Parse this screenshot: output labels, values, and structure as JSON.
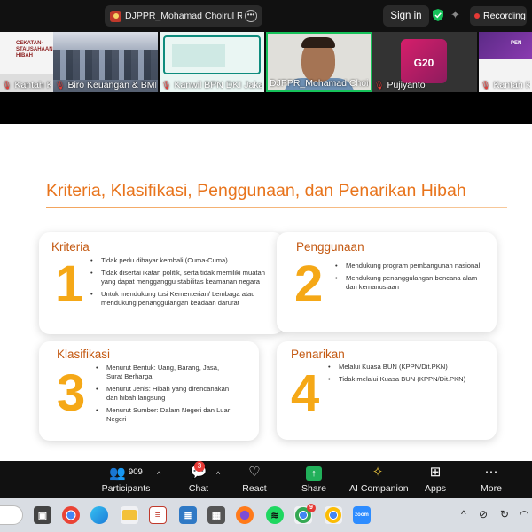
{
  "topbar": {
    "speaker_name": "DJPPR_Mohamad Choirul Rijal M",
    "sign_in": "Sign in",
    "recording": "Recording"
  },
  "gallery": {
    "tiles": [
      {
        "label": "Kantah Kab.Pa...",
        "thumb_text": "CEKATAN- STAUSAHAAN HIBAH",
        "muted": true
      },
      {
        "label": "Biro Keuangan & BMN",
        "muted": true
      },
      {
        "label": "Kanwil BPN DKI Jakart...",
        "muted": true
      },
      {
        "label": "DJPPR_Mohamad Choirul...",
        "muted": true
      },
      {
        "label": "Pujiyanto",
        "thumb_text": "G20",
        "muted": true
      },
      {
        "label": "Kantah Ko...",
        "thumb_text": "PEN",
        "muted": true
      }
    ]
  },
  "slide": {
    "title": "Kriteria, Klasifikasi, Penggunaan, dan Penarikan Hibah",
    "cards": [
      {
        "heading": "Kriteria",
        "number": "1",
        "items": [
          "Tidak perlu dibayar kembali (Cuma-Cuma)",
          "Tidak disertai ikatan politik, serta tidak memiliki muatan yang dapat mengganggu stabilitas keamanan negara",
          "Untuk mendukung tusi Kementerian/ Lembaga atau mendukung penanggulangan keadaan darurat"
        ]
      },
      {
        "heading": "Penggunaan",
        "number": "2",
        "items": [
          "Mendukung program pembangunan nasional",
          "Mendukung penanggulangan bencana alam dan kemanusiaan"
        ]
      },
      {
        "heading": "Klasifikasi",
        "number": "3",
        "items": [
          "Menurut Bentuk: Uang, Barang, Jasa, Surat Berharga",
          "Menurut Jenis: Hibah yang direncanakan dan hibah langsung",
          "Menurut Sumber: Dalam Negeri dan Luar Negeri"
        ]
      },
      {
        "heading": "Penarikan",
        "number": "4",
        "items": [
          "Melalui Kuasa BUN (KPPN/Dit.PKN)",
          "Tidak melalui Kuasa BUN (KPPN/Dit.PKN)"
        ]
      }
    ]
  },
  "toolbar": {
    "participants_label": "Participants",
    "participants_count": "909",
    "chat_label": "Chat",
    "chat_badge": "3",
    "react_label": "React",
    "share_label": "Share",
    "ai_label": "AI Companion",
    "apps_label": "Apps",
    "more_label": "More"
  },
  "taskbar": {
    "apps": [
      "file-explorer-icon",
      "chrome-icon",
      "edge-icon",
      "folder-icon",
      "excel-doc-icon",
      "notepad-icon",
      "calculator-icon",
      "firefox-icon",
      "spotify-icon",
      "chrome-icon",
      "chrome-icon",
      "zoom-icon"
    ],
    "chrome_badge": "9"
  },
  "colors": {
    "accent_orange": "#e8741c",
    "number_yellow": "#f5a817",
    "zoom_green": "#21b05a",
    "recording_red": "#e53935"
  }
}
